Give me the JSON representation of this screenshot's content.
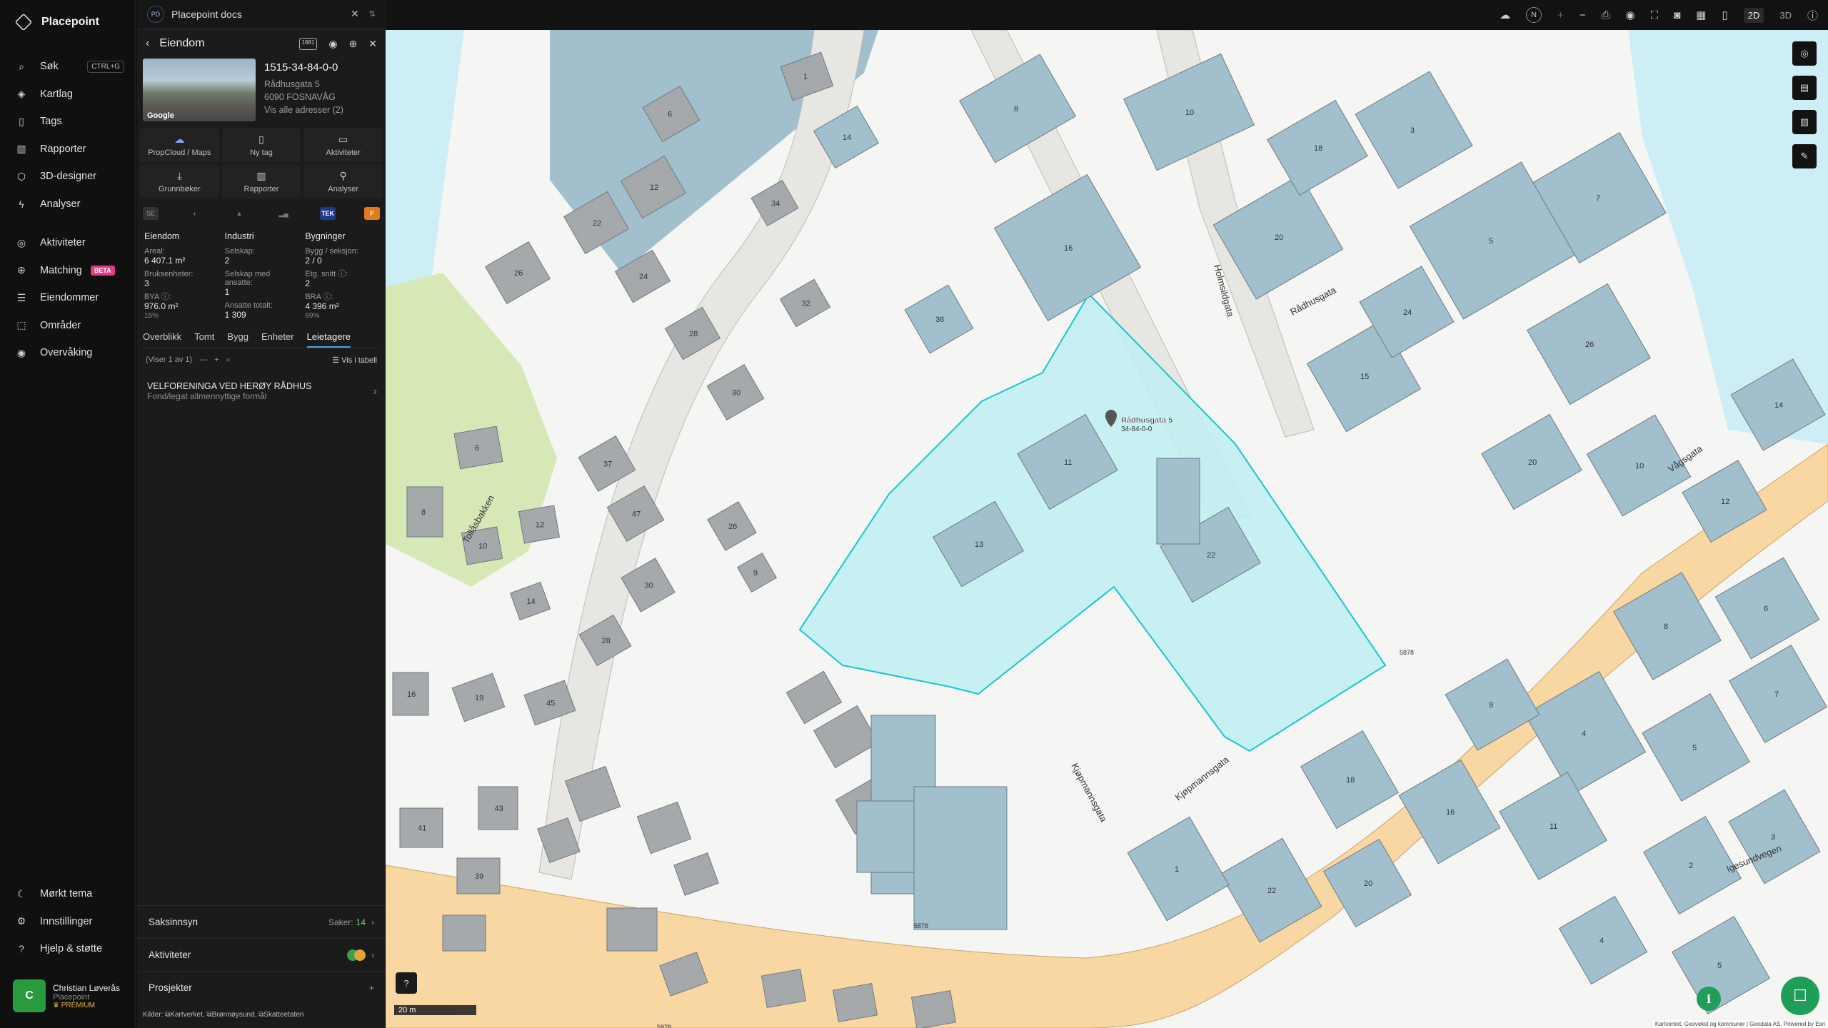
{
  "app": {
    "name": "Placepoint"
  },
  "nav": {
    "items": [
      {
        "label": "Søk",
        "icon": "search-icon",
        "kbd": "CTRL+G"
      },
      {
        "label": "Kartlag",
        "icon": "layers-icon"
      },
      {
        "label": "Tags",
        "icon": "bookmark-icon"
      },
      {
        "label": "Rapporter",
        "icon": "chart-icon"
      },
      {
        "label": "3D-designer",
        "icon": "cube-icon"
      },
      {
        "label": "Analyser",
        "icon": "bolt-icon"
      }
    ],
    "items2": [
      {
        "label": "Aktiviteter",
        "icon": "activity-icon"
      },
      {
        "label": "Matching",
        "icon": "matching-icon",
        "badge": "BETA"
      },
      {
        "label": "Eiendommer",
        "icon": "list-icon"
      },
      {
        "label": "Områder",
        "icon": "area-icon"
      },
      {
        "label": "Overvåking",
        "icon": "monitor-icon"
      }
    ],
    "bottom": [
      {
        "label": "Mørkt tema",
        "icon": "moon-icon"
      },
      {
        "label": "Innstillinger",
        "icon": "gear-icon"
      },
      {
        "label": "Hjelp & støtte",
        "icon": "help-icon"
      }
    ],
    "user": {
      "initial": "C",
      "name": "Christian Løverås",
      "org": "Placepoint",
      "plan": "PREMIUM"
    }
  },
  "panel": {
    "tab_badge": "PD",
    "tab_title": "Placepoint docs",
    "header": {
      "title": "Eiendom",
      "tag": "1881"
    },
    "property": {
      "id": "1515-34-84-0-0",
      "street": "Rådhusgata 5",
      "city": "6090 FOSNAVÅG",
      "all_addresses": "Vis alle adresser (2)",
      "photo_credit": "Google"
    },
    "actions": [
      {
        "label": "PropCloud / Maps",
        "icon": "cloud-icon"
      },
      {
        "label": "Ny tag",
        "icon": "bookmark-icon"
      },
      {
        "label": "Aktiviteter",
        "icon": "chat-icon"
      },
      {
        "label": "Grunnbøker",
        "icon": "download-icon"
      },
      {
        "label": "Rapporter",
        "icon": "chart-icon"
      },
      {
        "label": "Analyser",
        "icon": "pin-icon"
      }
    ],
    "sources": [
      "SE",
      "◐",
      "▲",
      "▂▄",
      "TEK",
      "F"
    ],
    "stats": {
      "col1": {
        "heading": "Eiendom",
        "rows": [
          {
            "k": "Areal:",
            "v": "6 407.1 m²"
          },
          {
            "k": "Bruksenheter:",
            "v": "3"
          },
          {
            "k": "BYA ⓘ:",
            "v": "976.0 m²",
            "p": "15%"
          }
        ]
      },
      "col2": {
        "heading": "Industri",
        "rows": [
          {
            "k": "Selskap:",
            "v": "2"
          },
          {
            "k": "Selskap med ansatte:",
            "v": "1"
          },
          {
            "k": "Ansatte totalt:",
            "v": "1 309"
          }
        ]
      },
      "col3": {
        "heading": "Bygninger",
        "rows": [
          {
            "k": "Bygg / seksjon:",
            "v": "2 / 0"
          },
          {
            "k": "Etg. snitt ⓘ:",
            "v": "2"
          },
          {
            "k": "BRA ⓘ:",
            "v": "4 396 m²",
            "p": "69%"
          }
        ]
      }
    },
    "tabs": [
      "Overblikk",
      "Tomt",
      "Bygg",
      "Enheter",
      "Leietagere"
    ],
    "active_tab": "Leietagere",
    "listbar": {
      "count": "(Viser 1 av 1)",
      "table": "Vis i tabell"
    },
    "tenant": {
      "name": "VELFORENINGA VED HERØY RÅDHUS",
      "type": "Fond/legat allmennyttige formål"
    },
    "accordions": [
      {
        "label": "Saksinnsyn",
        "meta": "Saker:",
        "count": "14"
      },
      {
        "label": "Aktiviteter"
      },
      {
        "label": "Prosjekter"
      }
    ],
    "sources_footer": {
      "label": "Kilder:",
      "items": [
        "Kartverket,",
        "Brønnøysund,",
        "Skatteetaten"
      ]
    }
  },
  "topbar": {
    "north": "N",
    "mode2d": "2D",
    "mode3d": "3D"
  },
  "map": {
    "marker_label_1": "Rådhusgata 5",
    "marker_label_2": "34-84-0-0",
    "scale": "20 m",
    "attribution": "Kartverket, Geovekst og kommuner | Geodata AS, Powered by Esri",
    "streets": [
      "Tollåsbakken",
      "Rådhusgata",
      "Holmsildgata",
      "Kjøpmannsgata",
      "Vågsgata",
      "Igesundvegen"
    ],
    "road_numbers": [
      "5878",
      "5878",
      "5878"
    ],
    "house_numbers": [
      "1",
      "6",
      "12",
      "14",
      "8",
      "10",
      "16",
      "20",
      "18",
      "3",
      "5",
      "7",
      "22",
      "26",
      "24",
      "28",
      "30",
      "32",
      "34",
      "36",
      "11",
      "13",
      "15",
      "24",
      "26",
      "22",
      "20",
      "10",
      "12",
      "14",
      "6",
      "8",
      "4",
      "5",
      "7",
      "9",
      "11",
      "16",
      "18",
      "20",
      "22",
      "1",
      "2",
      "3",
      "4",
      "5",
      "6",
      "8",
      "10",
      "12",
      "14",
      "16",
      "19",
      "45",
      "43",
      "41",
      "39",
      "37",
      "47",
      "30",
      "28",
      "26",
      "9"
    ],
    "colors": {
      "property_fill": "#bdeef1",
      "property_stroke": "#19c5d1",
      "building": "#a2bfcd",
      "road": "#f8d7a2",
      "water": "#cdeef4",
      "park": "#d6e8b6"
    }
  }
}
